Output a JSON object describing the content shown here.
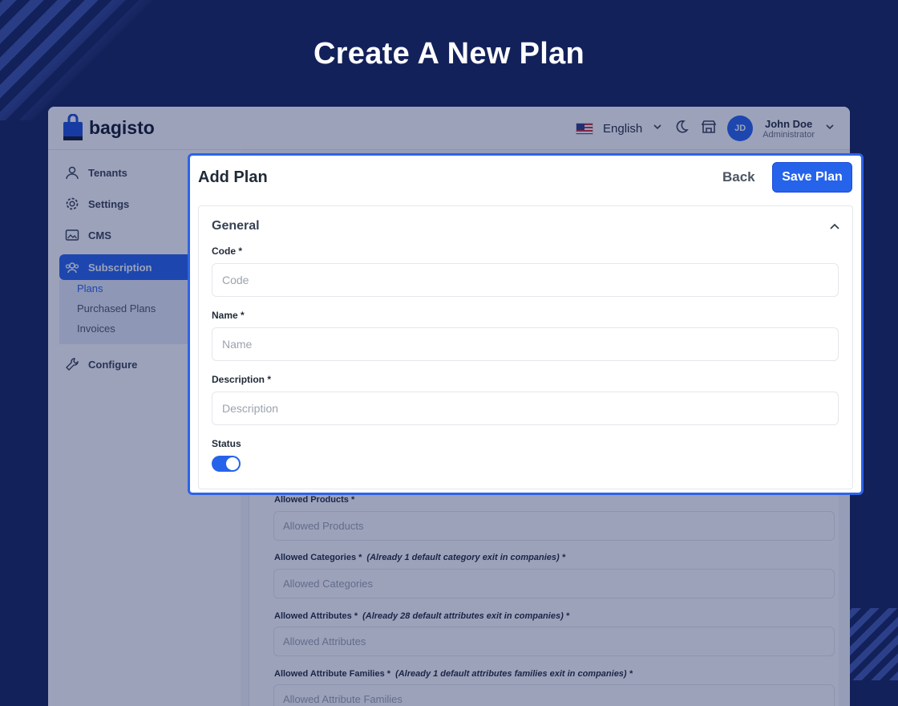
{
  "hero": {
    "title": "Create A New Plan"
  },
  "header": {
    "logo_text": "bagisto",
    "language": "English",
    "user_initials": "JD",
    "user_name": "John Doe",
    "user_role": "Administrator"
  },
  "sidebar": {
    "items": [
      {
        "label": "Tenants",
        "icon": "user-icon"
      },
      {
        "label": "Settings",
        "icon": "gear-icon"
      },
      {
        "label": "CMS",
        "icon": "image-icon"
      },
      {
        "label": "Subscription",
        "icon": "users-icon",
        "active": true
      },
      {
        "label": "Configure",
        "icon": "wrench-icon"
      }
    ],
    "sub_items": [
      "Plans",
      "Purchased Plans",
      "Invoices"
    ]
  },
  "background_form": {
    "fields": [
      {
        "label": "Allowed Products *",
        "note": "",
        "placeholder": "Allowed Products"
      },
      {
        "label": "Allowed Categories *",
        "note": "(Already 1 default category exit in companies) *",
        "placeholder": "Allowed Categories"
      },
      {
        "label": "Allowed Attributes *",
        "note": "(Already 28 default attributes exit in companies) *",
        "placeholder": "Allowed Attributes"
      },
      {
        "label": "Allowed Attribute Families *",
        "note": "(Already 1 default attributes families exit in companies) *",
        "placeholder": "Allowed Attribute Families"
      }
    ]
  },
  "modal": {
    "title": "Add Plan",
    "back_label": "Back",
    "save_label": "Save Plan",
    "section_title": "General",
    "code_label": "Code *",
    "code_placeholder": "Code",
    "name_label": "Name *",
    "name_placeholder": "Name",
    "description_label": "Description *",
    "description_placeholder": "Description",
    "status_label": "Status",
    "status_on": true
  },
  "colors": {
    "background": "#13215a",
    "accent": "#2563eb",
    "highlight_border": "#2d63e8"
  }
}
